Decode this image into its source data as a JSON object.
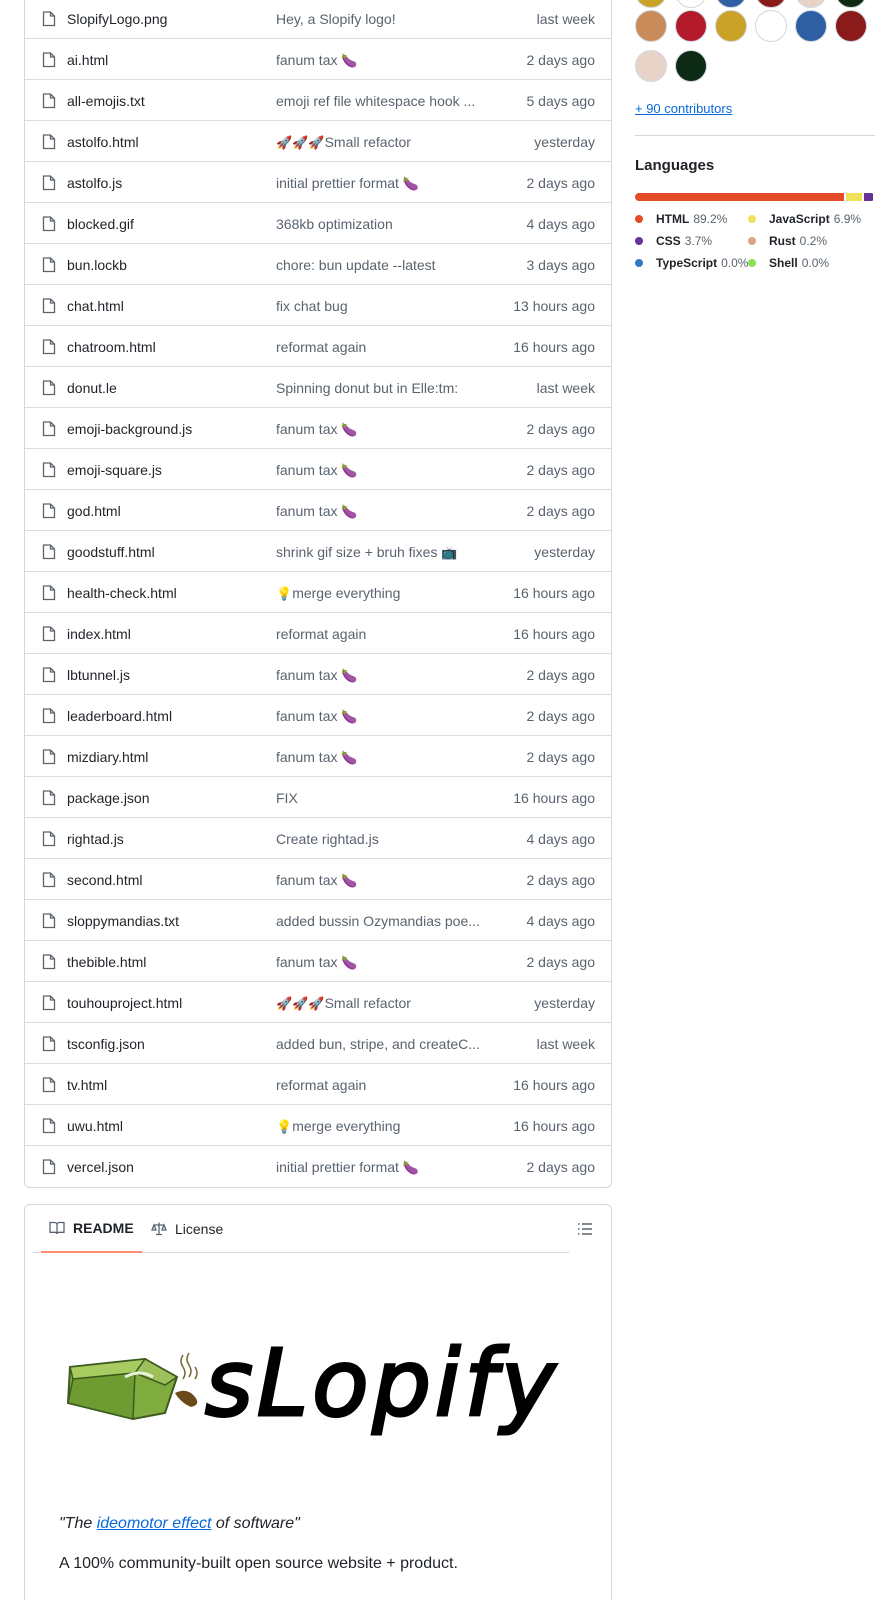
{
  "files": [
    {
      "name": "SlopifyLogo.png",
      "message": "Hey, a Slopify logo!",
      "emoji": "",
      "date": "last week"
    },
    {
      "name": "ai.html",
      "message": "fanum tax",
      "emoji": "🍆",
      "date": "2 days ago"
    },
    {
      "name": "all-emojis.txt",
      "message": "emoji ref file whitespace hook ...",
      "emoji": "",
      "date": "5 days ago"
    },
    {
      "name": "astolfo.html",
      "message": "Small refactor",
      "emoji_prefix": "🚀🚀🚀",
      "emoji": "",
      "date": "yesterday"
    },
    {
      "name": "astolfo.js",
      "message": "initial prettier format",
      "emoji": "🍆",
      "date": "2 days ago"
    },
    {
      "name": "blocked.gif",
      "message": "368kb optimization",
      "emoji": "",
      "date": "4 days ago"
    },
    {
      "name": "bun.lockb",
      "message": "chore: bun update --latest",
      "emoji": "",
      "date": "3 days ago"
    },
    {
      "name": "chat.html",
      "message": "fix chat bug",
      "emoji": "",
      "date": "13 hours ago"
    },
    {
      "name": "chatroom.html",
      "message": "reformat again",
      "emoji": "",
      "date": "16 hours ago"
    },
    {
      "name": "donut.le",
      "message": "Spinning donut but in Elle:tm:",
      "emoji": "",
      "date": "last week"
    },
    {
      "name": "emoji-background.js",
      "message": "fanum tax",
      "emoji": "🍆",
      "date": "2 days ago"
    },
    {
      "name": "emoji-square.js",
      "message": "fanum tax",
      "emoji": "🍆",
      "date": "2 days ago"
    },
    {
      "name": "god.html",
      "message": "fanum tax",
      "emoji": "🍆",
      "date": "2 days ago"
    },
    {
      "name": "goodstuff.html",
      "message": "shrink gif size + bruh fixes",
      "emoji": "📺",
      "date": "yesterday"
    },
    {
      "name": "health-check.html",
      "message": "merge everything",
      "emoji_prefix": "💡",
      "emoji": "",
      "date": "16 hours ago"
    },
    {
      "name": "index.html",
      "message": "reformat again",
      "emoji": "",
      "date": "16 hours ago"
    },
    {
      "name": "lbtunnel.js",
      "message": "fanum tax",
      "emoji": "🍆",
      "date": "2 days ago"
    },
    {
      "name": "leaderboard.html",
      "message": "fanum tax",
      "emoji": "🍆",
      "date": "2 days ago"
    },
    {
      "name": "mizdiary.html",
      "message": "fanum tax",
      "emoji": "🍆",
      "date": "2 days ago"
    },
    {
      "name": "package.json",
      "message": "FIX",
      "emoji": "",
      "date": "16 hours ago"
    },
    {
      "name": "rightad.js",
      "message": "Create rightad.js",
      "emoji": "",
      "date": "4 days ago"
    },
    {
      "name": "second.html",
      "message": "fanum tax",
      "emoji": "🍆",
      "date": "2 days ago"
    },
    {
      "name": "sloppymandias.txt",
      "message": "added bussin Ozymandias poe...",
      "emoji": "",
      "date": "4 days ago"
    },
    {
      "name": "thebible.html",
      "message": "fanum tax",
      "emoji": "🍆",
      "date": "2 days ago"
    },
    {
      "name": "touhouproject.html",
      "message": "Small refactor",
      "emoji_prefix": "🚀🚀🚀",
      "emoji": "",
      "date": "yesterday"
    },
    {
      "name": "tsconfig.json",
      "message": "added bun, stripe, and createC...",
      "emoji": "",
      "date": "last week"
    },
    {
      "name": "tv.html",
      "message": "reformat again",
      "emoji": "",
      "date": "16 hours ago"
    },
    {
      "name": "uwu.html",
      "message": "merge everything",
      "emoji_prefix": "💡",
      "emoji": "",
      "date": "16 hours ago"
    },
    {
      "name": "vercel.json",
      "message": "initial prettier format",
      "emoji": "🍆",
      "date": "2 days ago"
    }
  ],
  "readme": {
    "tab_readme": "README",
    "tab_license": "License",
    "logo_text": "sLopify",
    "tagline_prefix": "\"The ",
    "tagline_link": "ideomotor effect",
    "tagline_suffix": " of software\"",
    "description": "A 100% community-built open source website + product.",
    "more_partial": ""
  },
  "sidebar": {
    "contributors_link": "+ 90 contributors",
    "avatar_colors": [
      "#c9a227",
      "#ffffff",
      "#2e5fa3",
      "#8b1a1a",
      "#e8d3c8",
      "#0d2a14",
      "#c98b5a",
      "#b31b2a"
    ],
    "languages_title": "Languages",
    "languages": [
      {
        "name": "HTML",
        "pct": "89.2%",
        "value": 89.2,
        "color": "#e34c26"
      },
      {
        "name": "JavaScript",
        "pct": "6.9%",
        "value": 6.9,
        "color": "#f1e05a"
      },
      {
        "name": "CSS",
        "pct": "3.7%",
        "value": 3.7,
        "color": "#663399"
      },
      {
        "name": "Rust",
        "pct": "0.2%",
        "value": 0.2,
        "color": "#dea584"
      },
      {
        "name": "TypeScript",
        "pct": "0.0%",
        "value": 0.0,
        "color": "#3178c6"
      },
      {
        "name": "Shell",
        "pct": "0.0%",
        "value": 0.0,
        "color": "#89e051"
      }
    ]
  }
}
